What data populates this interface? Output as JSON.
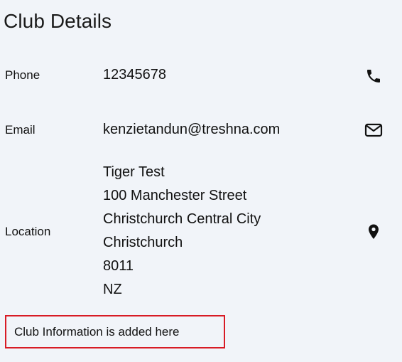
{
  "page": {
    "title": "Club Details"
  },
  "details": {
    "phone": {
      "label": "Phone",
      "value": "12345678",
      "icon": "phone-icon"
    },
    "email": {
      "label": "Email",
      "value": "kenzietandun@treshna.com",
      "icon": "mail-icon"
    },
    "location": {
      "label": "Location",
      "lines": [
        "Tiger Test",
        "100 Manchester Street",
        "Christchurch Central City",
        "Christchurch",
        "8011",
        "NZ"
      ],
      "icon": "map-pin-icon"
    }
  },
  "info": {
    "text": "Club Information is added here",
    "border_color": "#d81b25"
  }
}
